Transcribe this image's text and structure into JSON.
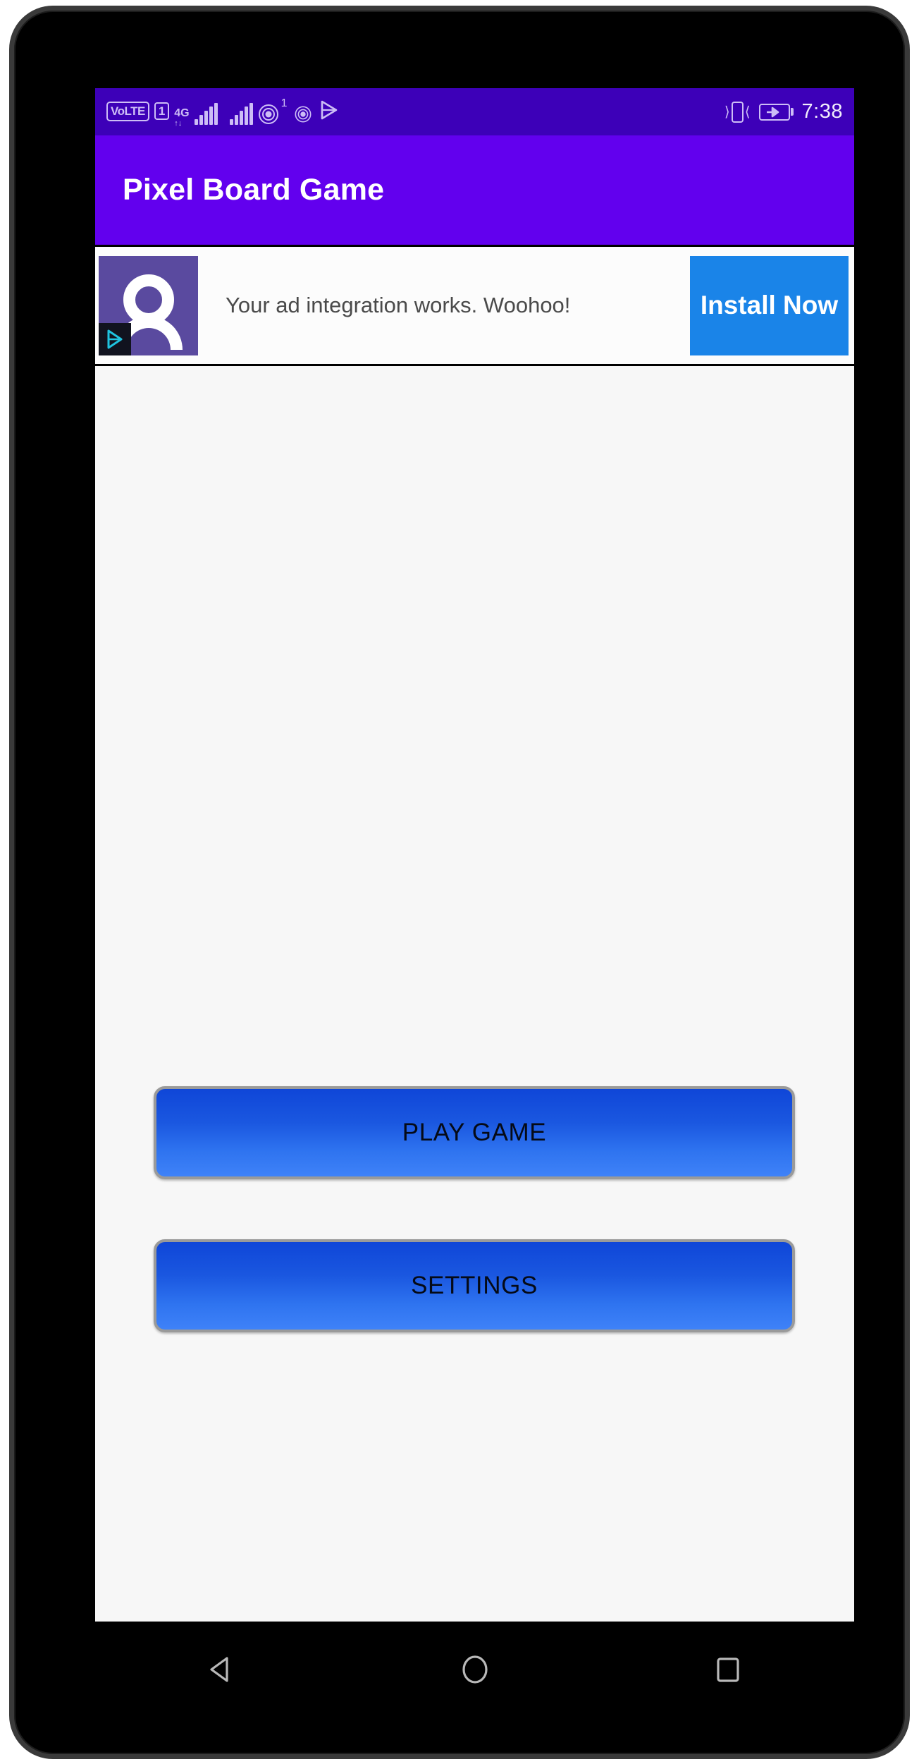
{
  "device": {
    "name": "android-phone"
  },
  "status_bar": {
    "volte_label": "VoLTE",
    "sim_label": "1",
    "network_label": "4G",
    "network_sub": "↑↓",
    "notification_badge": "1",
    "clock": "7:38",
    "bg_color": "#3d00b8",
    "icon_color": "#cdbdf6",
    "icons": [
      "volte-icon",
      "sim-card-icon",
      "network-4g-icon",
      "signal-bars-icon",
      "signal-bars-secondary-icon",
      "hotspot-icon",
      "hotspot-secondary-icon",
      "play-store-icon",
      "vibrate-icon",
      "battery-charging-icon"
    ]
  },
  "app_bar": {
    "title": "Pixel Board Game",
    "bg_color": "#6200ee",
    "text_color": "#ffffff"
  },
  "ad_banner": {
    "text": "Your ad integration works. Woohoo!",
    "cta_label": "Install Now",
    "cta_color": "#1a84e8",
    "icon_bg_color": "#5a4a9f",
    "adchoices_label": "adchoices-icon",
    "avatar_label": "ad-avatar-icon"
  },
  "content": {
    "bg_color": "#f7f7f7",
    "buttons": [
      {
        "label": "PLAY GAME",
        "name": "play-game-button"
      },
      {
        "label": "SETTINGS",
        "name": "settings-button"
      }
    ],
    "button_gradient_top": "#0f46d8",
    "button_gradient_bottom": "#3f82f8",
    "button_border_color": "#9a9a9a",
    "button_text_color": "#050a16"
  },
  "nav_bar": {
    "bg_color": "#000000",
    "icon_color": "#b8b8b8",
    "buttons": [
      {
        "name": "nav-back-button",
        "icon": "triangle-left-icon"
      },
      {
        "name": "nav-home-button",
        "icon": "circle-icon"
      },
      {
        "name": "nav-recents-button",
        "icon": "square-icon"
      }
    ]
  }
}
